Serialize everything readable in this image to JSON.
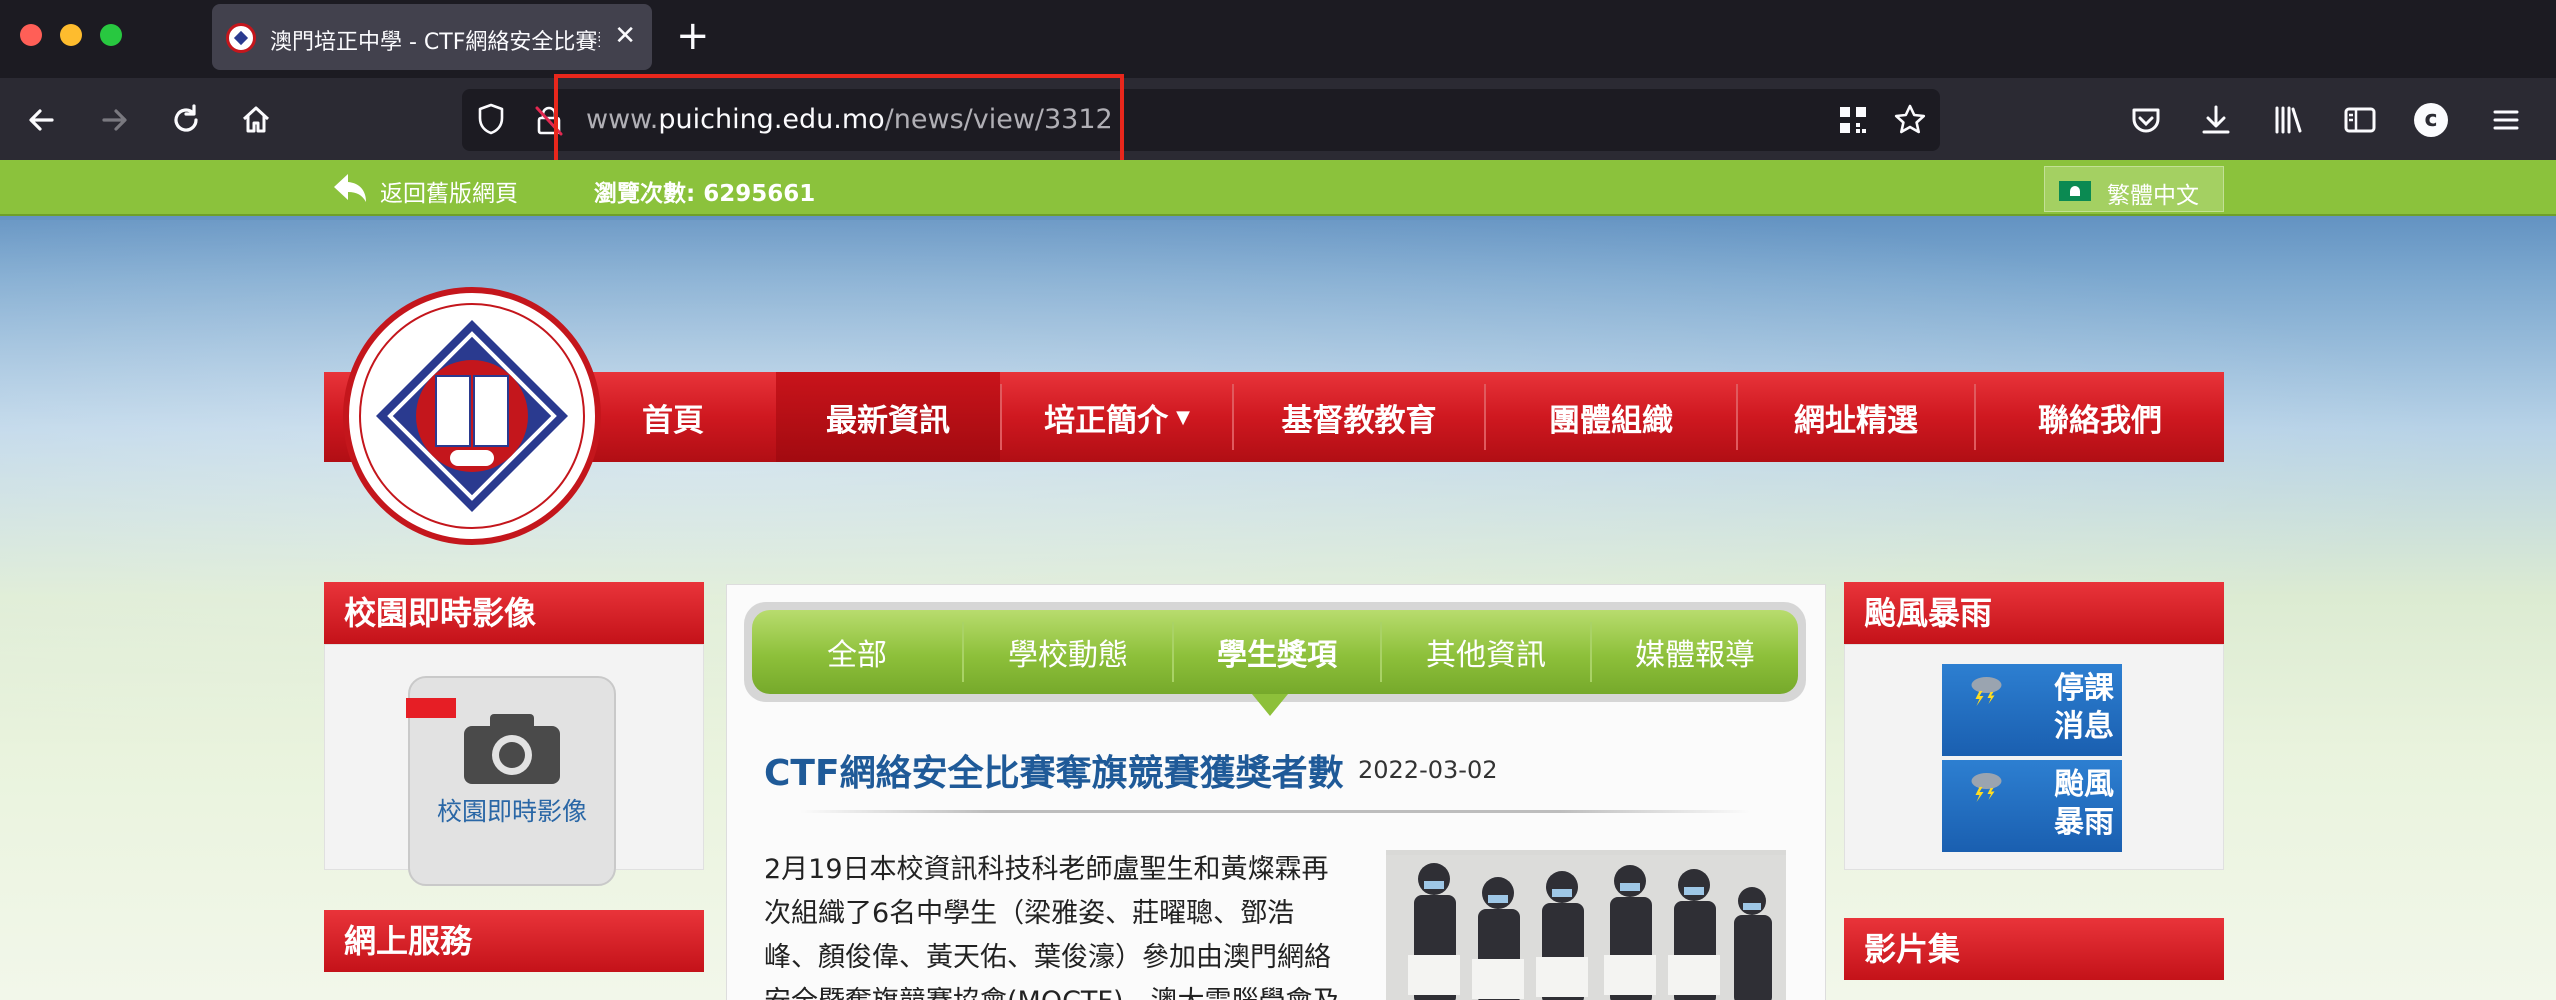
{
  "browser": {
    "tab_title": "澳門培正中學 - CTF網絡安全比賽奪",
    "url_prefix": "www.",
    "url_domain": "puiching.edu.mo",
    "url_path": "/news/view/3312"
  },
  "topbar": {
    "back_label": "返回舊版網頁",
    "visits_label": "瀏覽次數: 6295661",
    "language_label": "繁體中文"
  },
  "nav": {
    "items": [
      {
        "label": "首頁"
      },
      {
        "label": "最新資訊"
      },
      {
        "label": "培正簡介"
      },
      {
        "label": "基督教教育"
      },
      {
        "label": "團體組織"
      },
      {
        "label": "網址精選"
      },
      {
        "label": "聯絡我們"
      }
    ],
    "active_index": 1
  },
  "left": {
    "campus_title": "校園即時影像",
    "campus_button_label": "校園即時影像",
    "online_title": "網上服務"
  },
  "news": {
    "tabs": [
      {
        "label": "全部"
      },
      {
        "label": "學校動態"
      },
      {
        "label": "學生獎項"
      },
      {
        "label": "其他資訊"
      },
      {
        "label": "媒體報導"
      }
    ],
    "active_tab": 2,
    "title": "CTF網絡安全比賽奪旗競賽獲獎者數",
    "date": "2022-03-02",
    "body_lines": [
      "2月19日本校資訊科技科老師盧聖生和黃燦霖再",
      "次組織了6名中學生（梁雅姿、莊曜聰、鄧浩",
      "峰、顏俊偉、黃天佑、葉俊濠）參加由澳門網絡",
      "安全暨奪旗競賽協會(MOCTF)、澳大電腦學會及"
    ]
  },
  "right": {
    "weather_title": "颱風暴雨",
    "alert_suspension": "停課消息",
    "alert_typhoon": "颱風暴雨",
    "video_title": "影片集"
  },
  "colors": {
    "accent_red": "#cf1820",
    "accent_green": "#8bc23c",
    "title_blue": "#1f5a98",
    "url_highlight": "#e8271c"
  }
}
